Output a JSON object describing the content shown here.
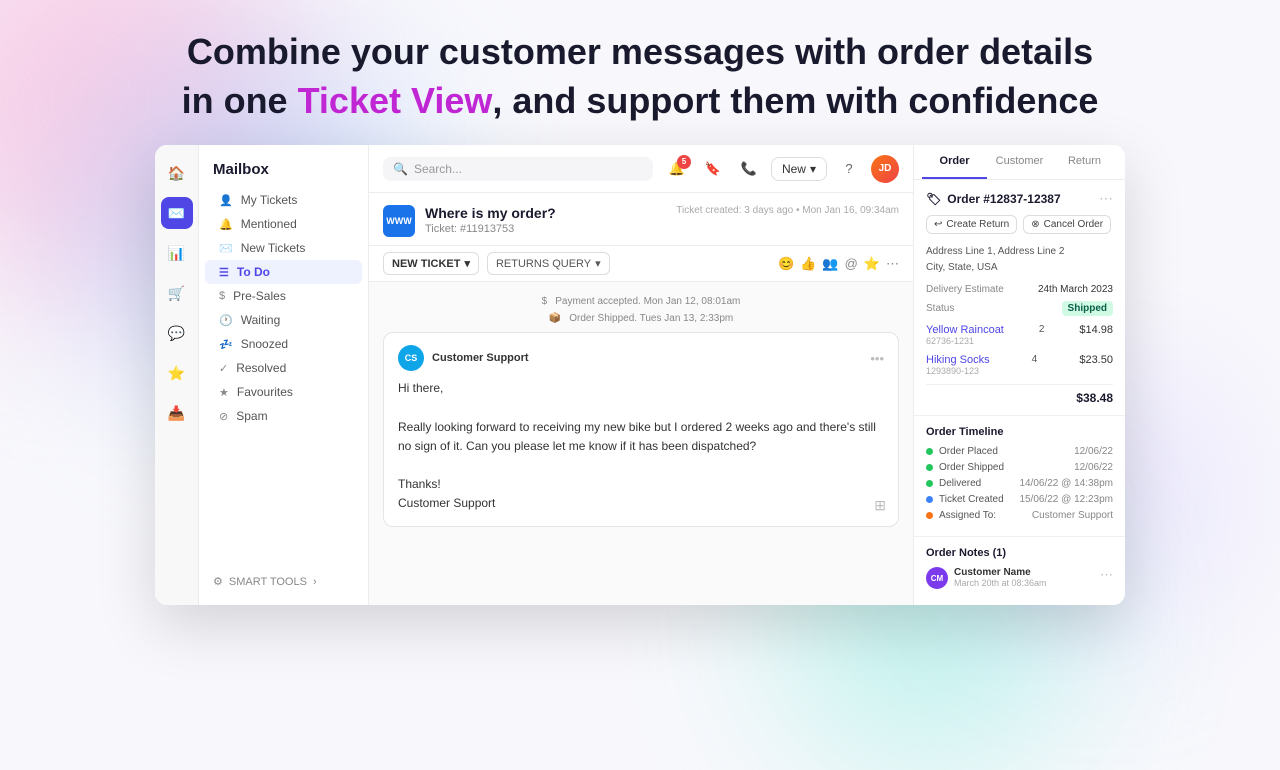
{
  "hero": {
    "line1": "Combine your customer messages with order details",
    "line2_before": "in one ",
    "line2_accent": "Ticket View",
    "line2_after": ", and support them with confidence"
  },
  "topbar": {
    "search_placeholder": "Search...",
    "notif_count": "5",
    "new_btn_label": "New",
    "help_icon": "?",
    "avatar_initials": "JD"
  },
  "sidebar": {
    "title": "Mailbox",
    "items": [
      {
        "label": "My Tickets",
        "icon": "👤",
        "active": false
      },
      {
        "label": "Mentioned",
        "icon": "🔔",
        "active": false
      },
      {
        "label": "New Tickets",
        "icon": "✉️",
        "active": false
      },
      {
        "label": "To Do",
        "icon": "☰",
        "active": true
      },
      {
        "label": "Pre-Sales",
        "icon": "$",
        "active": false
      },
      {
        "label": "Waiting",
        "icon": "🕐",
        "active": false
      },
      {
        "label": "Snoozed",
        "icon": "💤",
        "active": false
      },
      {
        "label": "Resolved",
        "icon": "✓",
        "active": false
      },
      {
        "label": "Favourites",
        "icon": "★",
        "active": false
      },
      {
        "label": "Spam",
        "icon": "⊘",
        "active": false
      }
    ],
    "smart_tools_label": "SMART TOOLS"
  },
  "ticket": {
    "favicon_text": "WWW",
    "subject": "Where is my order?",
    "id": "Ticket: #11913753",
    "created": "Ticket created: 3 days ago",
    "date": "Mon Jan 16, 09:34am",
    "new_ticket_label": "NEW TICKET",
    "returns_label": "RETURNS QUERY"
  },
  "events": [
    {
      "icon": "$",
      "text": "Payment accepted. Mon Jan 12, 08:01am"
    },
    {
      "icon": "📦",
      "text": "Order Shipped. Tues Jan 13, 2:33pm"
    }
  ],
  "message": {
    "avatar": "CS",
    "author": "Customer Support",
    "greeting": "Hi there,",
    "body": "Really looking forward to receiving my new bike but I ordered 2 weeks ago and there's still no sign of it. Can you please let me know if it has been dispatched?",
    "sign_off": "Thanks!",
    "signature": "Customer Support"
  },
  "panel": {
    "tabs": [
      {
        "label": "Order",
        "active": true
      },
      {
        "label": "Customer",
        "active": false
      },
      {
        "label": "Return",
        "active": false
      }
    ],
    "order": {
      "number": "Order #12837-12387",
      "create_return_label": "Create Return",
      "cancel_order_label": "Cancel Order",
      "address_line1": "Address Line 1, Address Line 2",
      "address_line2": "City, State, USA",
      "delivery_label": "Delivery Estimate",
      "delivery_value": "24th March 2023",
      "status_label": "Status",
      "status_value": "Shipped",
      "items": [
        {
          "name": "Yellow Raincoat",
          "sku": "62736-1231",
          "qty": "2",
          "price": "$14.98"
        },
        {
          "name": "Hiking Socks",
          "sku": "1293890-123",
          "qty": "4",
          "price": "$23.50"
        }
      ],
      "total": "$38.48"
    },
    "timeline": {
      "title": "Order Timeline",
      "items": [
        {
          "label": "Order Placed",
          "date": "12/06/22",
          "dot": "green"
        },
        {
          "label": "Order Shipped",
          "date": "12/06/22",
          "dot": "green"
        },
        {
          "label": "Delivered",
          "date": "14/06/22 @ 14:38pm",
          "dot": "green"
        },
        {
          "label": "Ticket Created",
          "date": "15/06/22 @ 12:23pm",
          "dot": "blue"
        },
        {
          "label": "Assigned To:",
          "date": "Customer Support",
          "dot": "orange"
        }
      ]
    },
    "notes": {
      "title": "Order Notes (1)",
      "items": [
        {
          "avatar": "CM",
          "author": "Customer Name",
          "date": "March 20th at 08:36am"
        }
      ]
    }
  }
}
